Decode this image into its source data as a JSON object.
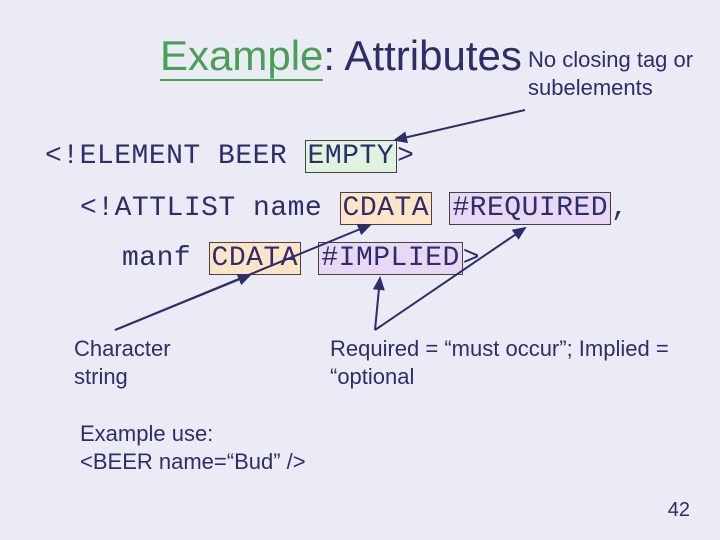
{
  "title": {
    "accent": "Example",
    "rest": ": Attributes"
  },
  "annotations": {
    "top": "No closing tag or subelements",
    "left": "Character string",
    "right": "Required = “must occur”; Implied = “optional"
  },
  "code": {
    "line1_pre": "<!ELEMENT BEER ",
    "line1_box": "EMPTY",
    "line1_post": ">",
    "line2_pre": "<!ATTLIST name ",
    "line2_box": "CDATA",
    "line2_mid": " ",
    "line2_box2": "#REQUIRED",
    "line2_post": ",",
    "line3_pre": "manf ",
    "line3_box": "CDATA",
    "line3_mid": " ",
    "line3_box2": "#IMPLIED",
    "line3_post": ">"
  },
  "example_use": {
    "label": "Example use:",
    "text": "<BEER name=“Bud” />"
  },
  "page_number": "42"
}
